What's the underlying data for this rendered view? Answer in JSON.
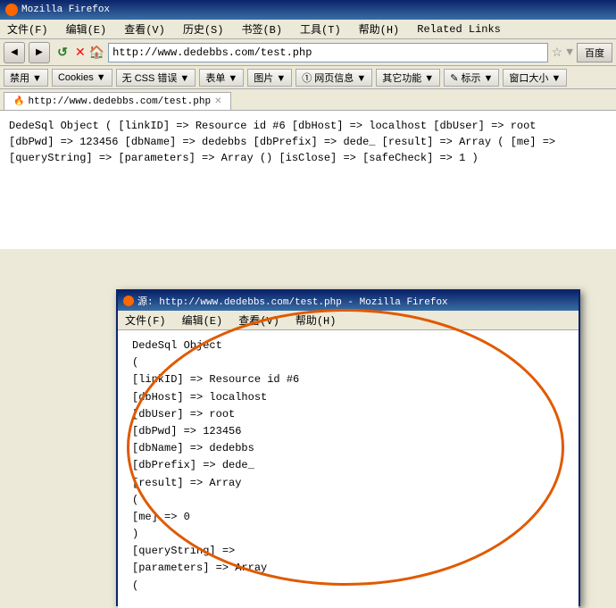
{
  "browser": {
    "title": "Mozilla Firefox",
    "title_icon": "firefox-icon",
    "menu": [
      "文件(F)",
      "编辑(E)",
      "查看(V)",
      "历史(S)",
      "书签(B)",
      "工具(T)",
      "帮助(H)",
      "Related Links"
    ],
    "toolbar": {
      "url": "http://www.dedebbs.com/test.php",
      "search_placeholder": "百度"
    },
    "toolbar2_buttons": [
      "禁用 ▼",
      "Cookies ▼",
      "无 CSS 错误 ▼",
      "表单 ▼",
      "图片 ▼",
      "① 网页信息 ▼",
      "其它功能 ▼",
      "✎ 标示 ▼",
      "窗口大小 ▼"
    ],
    "tab_label": "http://www.dedebbs.com/test.php"
  },
  "page_content": {
    "text_line1": "DedeSql Object ( [linkID] => Resource id #6 [dbHost] => localhost [dbUser] => root",
    "text_line2": "[dbPwd] => 123456 [dbName] => dedebbs [dbPrefix] => dede_ [result] => Array ( [me] =>",
    "text_line3": "[queryString] => [parameters] => Array () [isClose] => [safeCheck] => 1 )"
  },
  "popup": {
    "title": "源: http://www.dedebbs.com/test.php - Mozilla Firefox",
    "menu": [
      "文件(F)",
      "编辑(E)",
      "查看(V)",
      "帮助(H)"
    ],
    "content_lines": [
      "DedeSql Object",
      "(",
      "        [linkID] => Resource id #6",
      "        [dbHost] => localhost",
      "        [dbUser] => root",
      "        [dbPwd] => 123456",
      "        [dbName] => dedebbs",
      "        [dbPrefix] => dede_",
      "        [result] => Array",
      "                (",
      "                        [me] => 0",
      "                )",
      "",
      "        [queryString] =>",
      "        [parameters] => Array",
      "                ("
    ]
  }
}
